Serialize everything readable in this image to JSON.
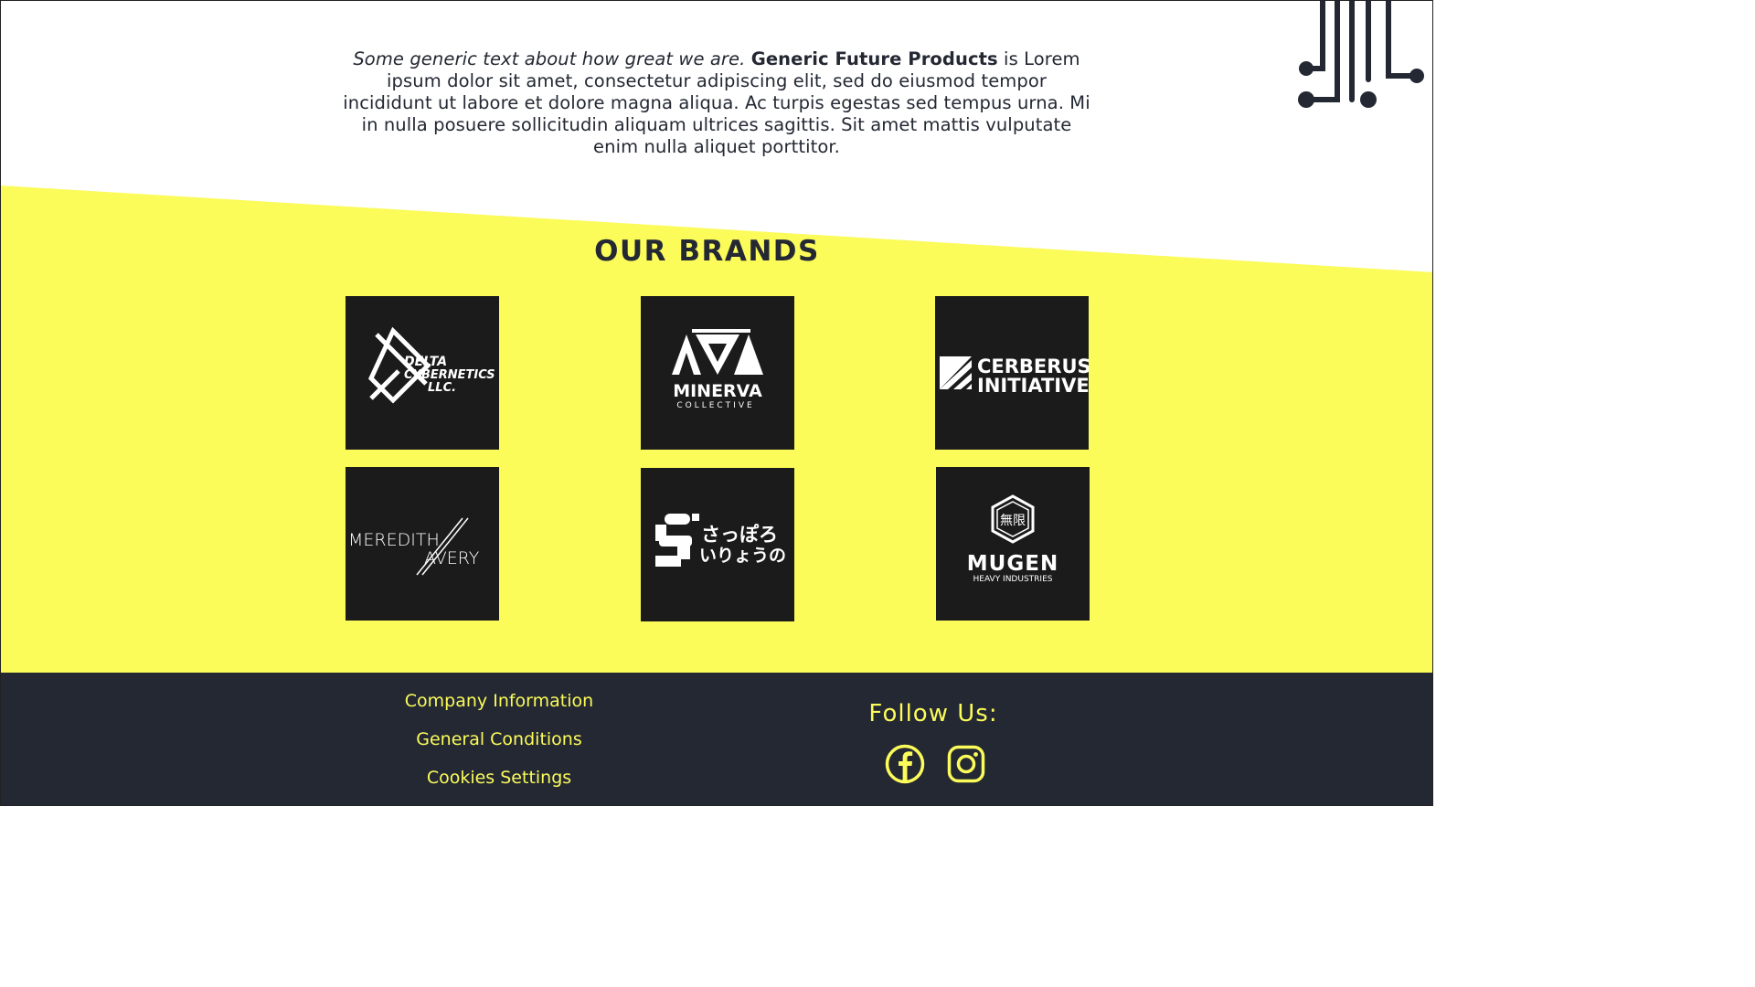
{
  "intro": {
    "italic_text": "Some generic text about how great we are.",
    "company_name": "Generic Future Products",
    "body_text": " is Lorem ipsum dolor sit amet, consectetur adipiscing elit, sed do eiusmod tempor incididunt ut labore et dolore magna aliqua. Ac turpis egestas sed tempus urna. Mi in nulla posuere sollicitudin aliquam ultrices sagittis. Sit amet mattis vulputate enim nulla aliquet porttitor."
  },
  "brands": {
    "title": "OUR BRANDS",
    "items": [
      {
        "line1": "DELTA",
        "line2": "CYBERNETICS",
        "line3": "LLC."
      },
      {
        "name": "MINERVA",
        "sub": "COLLECTIVE"
      },
      {
        "line1": "CERBERUS",
        "line2": "INITIATIVE"
      },
      {
        "line1": "MEREDITH",
        "line2": "AVERY"
      },
      {
        "line1": "さっぽろ",
        "line2": "いりょうの"
      },
      {
        "kanji": "無限",
        "name": "MUGEN",
        "sub": "HEAVY INDUSTRIES"
      }
    ]
  },
  "footer": {
    "links": [
      "Company Information",
      "General Conditions",
      "Cookies Settings"
    ],
    "follow_label": "Follow Us:",
    "social": [
      "facebook-icon",
      "instagram-icon"
    ]
  },
  "colors": {
    "accent_yellow": "#fbfb5a",
    "dark_navy": "#232833",
    "tile_black": "#1b1b1b"
  }
}
